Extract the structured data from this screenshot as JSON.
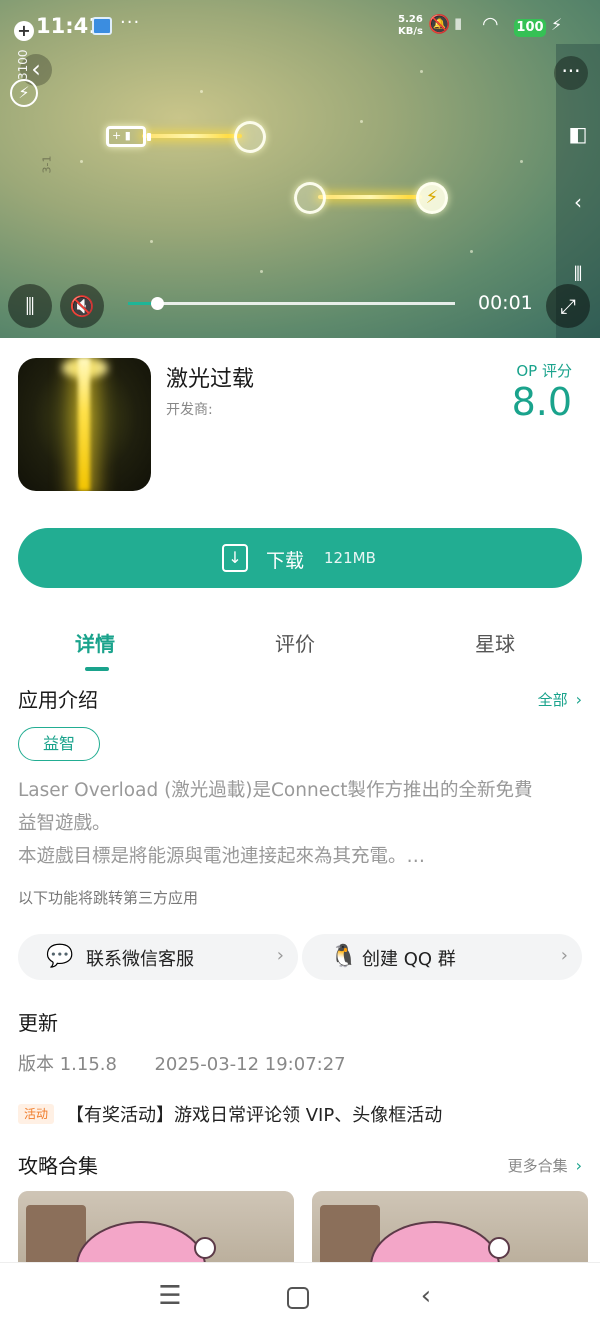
{
  "status_bar": {
    "time": "11:41",
    "more": "···",
    "net_speed": "5.26",
    "net_unit": "KB/s",
    "battery": "100"
  },
  "video": {
    "level_badge": "3100",
    "stage": "3-1",
    "time": "00:01",
    "progress": 0.09
  },
  "app": {
    "name": "激光过载",
    "developer_label": "开发商:",
    "score_label": "OP 评分",
    "score": "8.0"
  },
  "download": {
    "label": "下载",
    "size": "121MB"
  },
  "tabs": [
    {
      "label": "详情",
      "active": true
    },
    {
      "label": "评价",
      "active": false
    },
    {
      "label": "星球",
      "active": false
    }
  ],
  "intro": {
    "title": "应用介绍",
    "all_link": "全部",
    "tag": "益智",
    "line1": "Laser Overload (激光過載)是Connect製作方推出的全新免費",
    "line2": "益智遊戲。",
    "line3": "本遊戲目標是將能源與電池連接起來為其充電。…",
    "note": "以下功能将跳转第三方应用"
  },
  "contacts": {
    "wechat": "联系微信客服",
    "qq": "创建 QQ 群"
  },
  "update": {
    "title": "更新",
    "version": "版本 1.15.8",
    "date": "2025-03-12 19:07:27"
  },
  "activity": {
    "badge": "活动",
    "text": "【有奖活动】游戏日常评论领 VIP、头像框活动"
  },
  "guides": {
    "title": "攻略合集",
    "more_link": "更多合集"
  },
  "colors": {
    "accent": "#22ad92",
    "accent_text": "#1aa38c"
  }
}
